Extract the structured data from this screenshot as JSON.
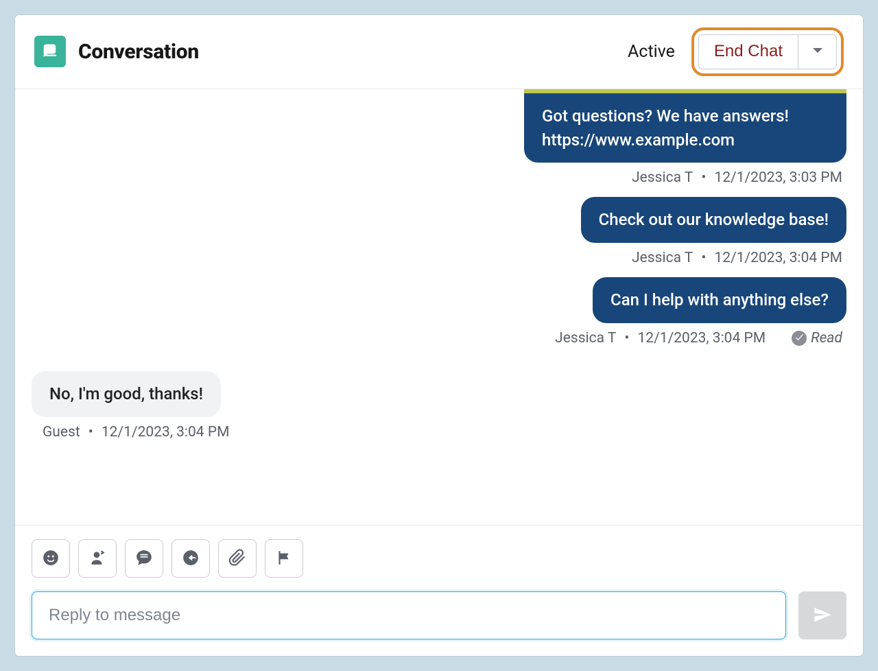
{
  "header": {
    "title": "Conversation",
    "status": "Active",
    "end_chat_label": "End Chat"
  },
  "messages": [
    {
      "role": "agent",
      "text": "Got questions? We have answers! https://www.example.com",
      "author": "Jessica T",
      "time": "12/1/2023, 3:03 PM",
      "read": false,
      "first": true
    },
    {
      "role": "agent",
      "text": "Check out our knowledge base!",
      "author": "Jessica T",
      "time": "12/1/2023, 3:04 PM",
      "read": false,
      "first": false
    },
    {
      "role": "agent",
      "text": "Can I help with anything else?",
      "author": "Jessica T",
      "time": "12/1/2023, 3:04 PM",
      "read": true,
      "read_label": "Read",
      "first": false
    },
    {
      "role": "guest",
      "text": "No, I'm good, thanks!",
      "author": "Guest",
      "time": "12/1/2023, 3:04 PM",
      "read": false,
      "first": false
    }
  ],
  "composer": {
    "placeholder": "Reply to message"
  },
  "colors": {
    "agent_bubble": "#18467a",
    "brand": "#39b39a",
    "highlight": "#e08a2a"
  }
}
